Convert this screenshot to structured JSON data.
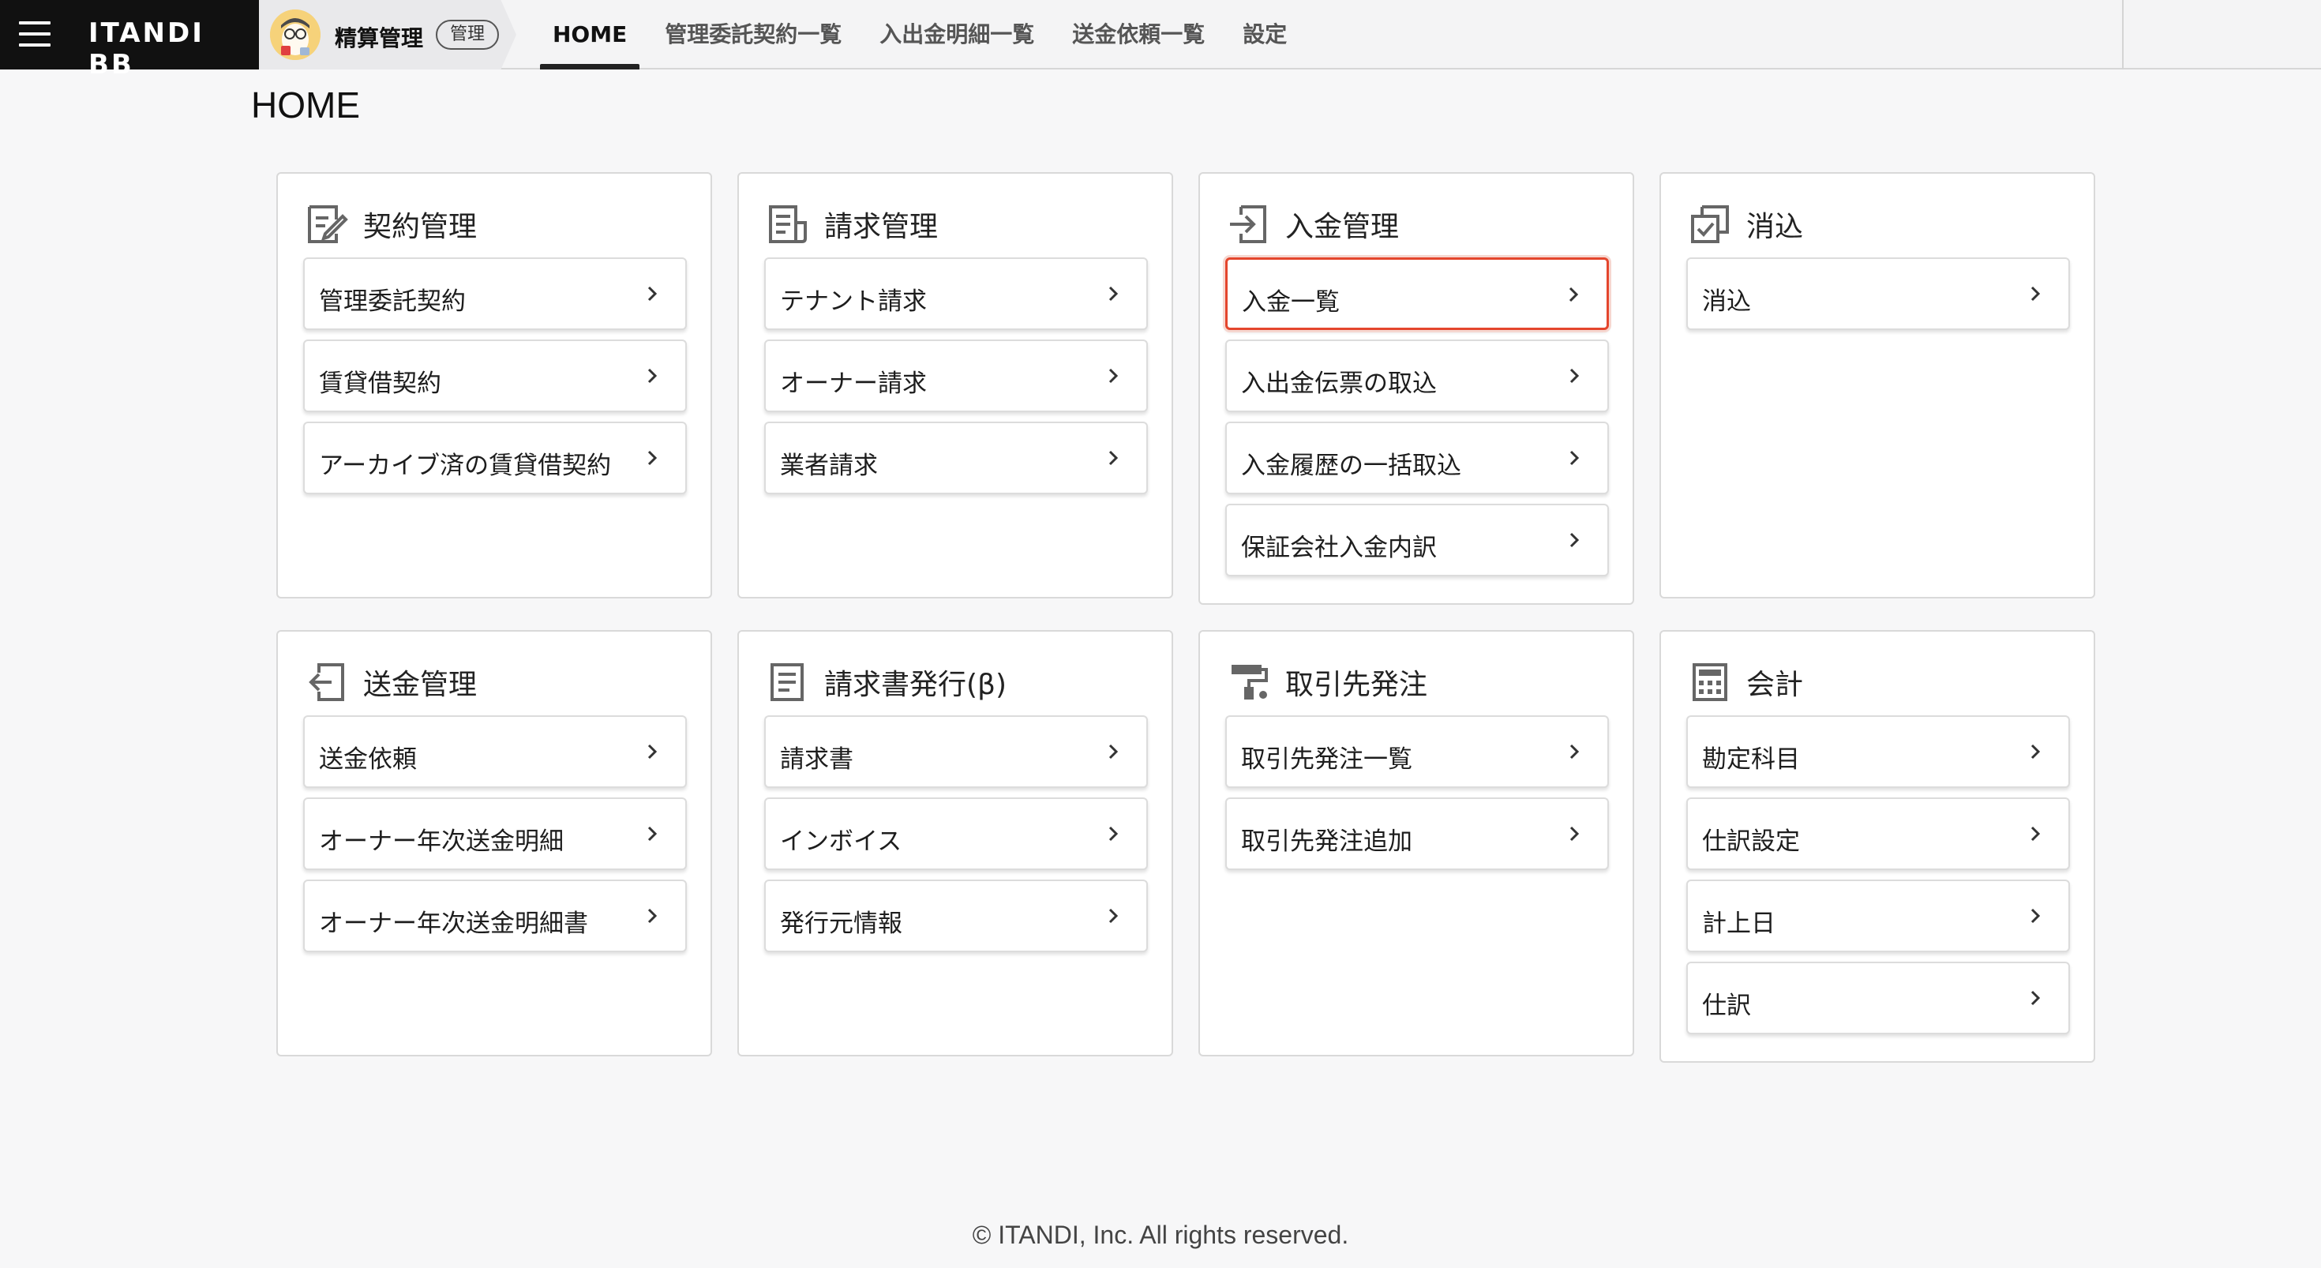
{
  "header": {
    "brand": "ITANDI BB",
    "app_name": "精算管理",
    "app_badge": "管理",
    "nav": [
      {
        "label": "HOME",
        "active": true
      },
      {
        "label": "管理委託契約一覧"
      },
      {
        "label": "入出金明細一覧"
      },
      {
        "label": "送金依頼一覧"
      },
      {
        "label": "設定"
      }
    ]
  },
  "page": {
    "title": "HOME"
  },
  "cards": [
    {
      "title": "契約管理",
      "icon": "contract-edit-icon",
      "items": [
        "管理委託契約",
        "賃貸借契約",
        "アーカイブ済の賃貸借契約"
      ]
    },
    {
      "title": "請求管理",
      "icon": "invoice-list-icon",
      "items": [
        "テナント請求",
        "オーナー請求",
        "業者請求"
      ]
    },
    {
      "title": "入金管理",
      "icon": "payment-in-icon",
      "items": [
        "入金一覧",
        "入出金伝票の取込",
        "入金履歴の一括取込",
        "保証会社入金内訳"
      ]
    },
    {
      "title": "消込",
      "icon": "reconcile-icon",
      "items": [
        "消込"
      ]
    },
    {
      "title": "送金管理",
      "icon": "payment-out-icon",
      "items": [
        "送金依頼",
        "オーナー年次送金明細",
        "オーナー年次送金明細書"
      ]
    },
    {
      "title": "請求書発行(β)",
      "icon": "document-icon",
      "items": [
        "請求書",
        "インボイス",
        "発行元情報"
      ]
    },
    {
      "title": "取引先発注",
      "icon": "paint-roller-icon",
      "items": [
        "取引先発注一覧",
        "取引先発注追加"
      ]
    },
    {
      "title": "会計",
      "icon": "calculator-icon",
      "items": [
        "勘定科目",
        "仕訳設定",
        "計上日",
        "仕訳"
      ]
    }
  ],
  "focused_item": "入金一覧",
  "colors": {
    "focus": "#e4462d",
    "brand_bg": "#111111"
  },
  "footer": {
    "text": "© ITANDI, Inc. All rights reserved."
  }
}
